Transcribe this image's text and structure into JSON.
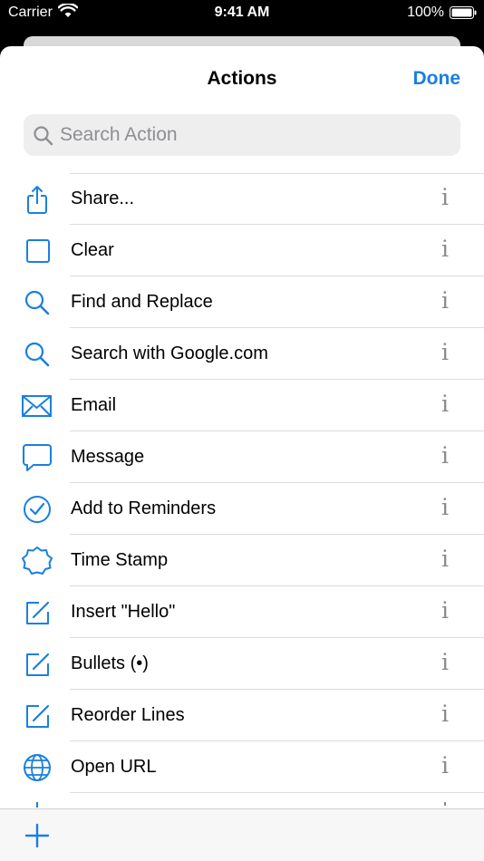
{
  "status": {
    "carrier": "Carrier",
    "time": "9:41 AM",
    "battery": "100%"
  },
  "header": {
    "title": "Actions",
    "done_label": "Done"
  },
  "search": {
    "placeholder": "Search Action",
    "value": ""
  },
  "info_glyph": "i",
  "colors": {
    "accent": "#1a7fe0",
    "info": "#8a8a8a",
    "separator": "#dcdcdc"
  },
  "actions": [
    {
      "label": "Share...",
      "icon": "share-icon"
    },
    {
      "label": "Clear",
      "icon": "square-icon"
    },
    {
      "label": "Find and Replace",
      "icon": "search-icon"
    },
    {
      "label": "Search with Google.com",
      "icon": "search-icon"
    },
    {
      "label": "Email",
      "icon": "envelope-icon"
    },
    {
      "label": "Message",
      "icon": "message-bubble-icon"
    },
    {
      "label": "Add to Reminders",
      "icon": "checkmark-circle-icon"
    },
    {
      "label": "Time Stamp",
      "icon": "seal-icon"
    },
    {
      "label": "Insert \"Hello\"",
      "icon": "compose-icon"
    },
    {
      "label": "Bullets (•)",
      "icon": "compose-icon"
    },
    {
      "label": "Reorder Lines",
      "icon": "compose-icon"
    },
    {
      "label": "Open URL",
      "icon": "globe-icon"
    }
  ]
}
